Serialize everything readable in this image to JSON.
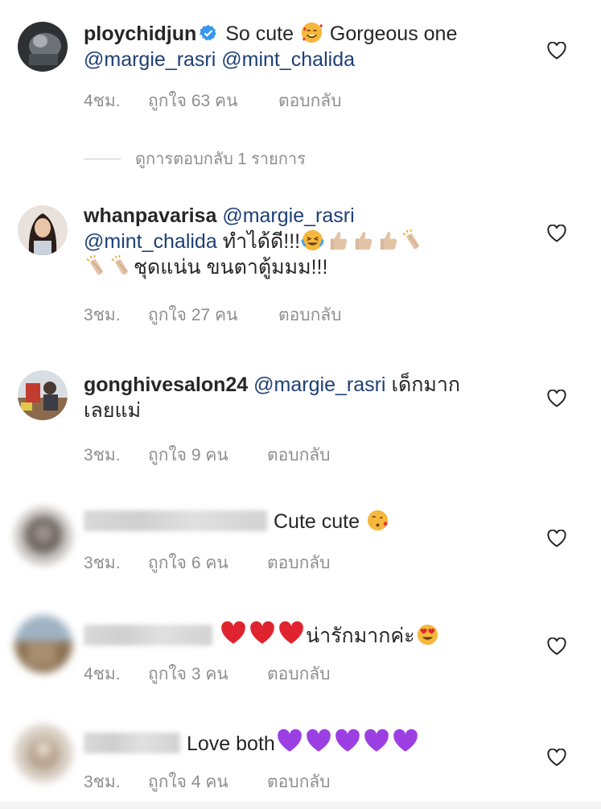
{
  "comments": [
    {
      "username": "ploychidjun",
      "verified": true,
      "text": "So cute",
      "text2": "Gorgeous one",
      "mention1": "@margie_rasri",
      "mention2": "@mint_chalida",
      "time": "4ชม.",
      "likes": "ถูกใจ 63 คน",
      "reply": "ตอบกลับ"
    },
    {
      "username": "whanpavarisa",
      "mention1": "@margie_rasri",
      "mention2": "@mint_chalida",
      "text": "ทำได้ดี!!!",
      "text2": "ชุดแน่น ขนตาตู้มมม!!!",
      "time": "3ชม.",
      "likes": "ถูกใจ 27 คน",
      "reply": "ตอบกลับ"
    },
    {
      "username": "gonghivesalon24",
      "mention1": "@margie_rasri",
      "text": "เด็กมาก",
      "text2": "เลยแม่",
      "time": "3ชม.",
      "likes": "ถูกใจ 9 คน",
      "reply": "ตอบกลับ"
    },
    {
      "text": "Cute cute",
      "time": "3ชม.",
      "likes": "ถูกใจ 6 คน",
      "reply": "ตอบกลับ"
    },
    {
      "text": "น่ารักมากค่ะ",
      "time": "4ชม.",
      "likes": "ถูกใจ 3 คน",
      "reply": "ตอบกลับ"
    },
    {
      "text": "Love both",
      "time": "3ชม.",
      "likes": "ถูกใจ 4 คน",
      "reply": "ตอบกลับ"
    }
  ],
  "view_replies": "ดูการตอบกลับ 1 รายการ",
  "icons": {
    "heart": "heart-outline-icon",
    "verified": "verified-badge-icon"
  },
  "colors": {
    "mention": "#1e3f76",
    "meta": "#8e8e8e",
    "verified": "#3897f0"
  }
}
